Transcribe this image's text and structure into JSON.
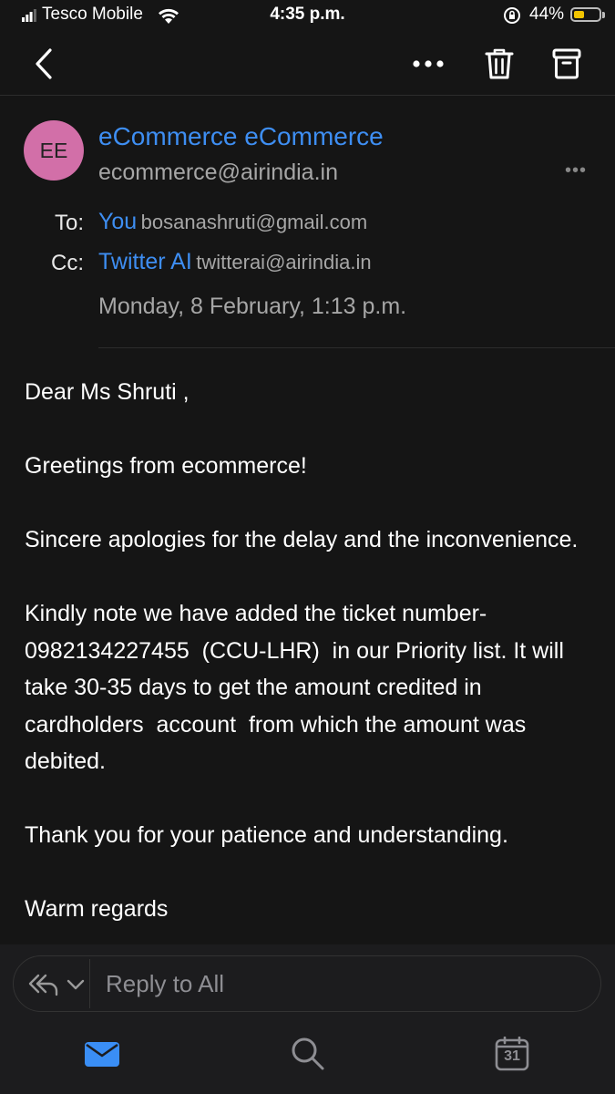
{
  "status_bar": {
    "carrier": "Tesco Mobile",
    "time": "4:35 p.m.",
    "battery_percent": "44%",
    "battery_level": 0.44
  },
  "nav": {
    "back_icon": "chevron-left-icon",
    "more_icon": "ellipsis-icon",
    "delete_icon": "trash-icon",
    "archive_icon": "archive-icon"
  },
  "header": {
    "avatar_initials": "EE",
    "sender_name": "eCommerce eCommerce",
    "sender_email": "ecommerce@airindia.in",
    "more": "•••",
    "to_label": "To:",
    "to_name": "You",
    "to_email": "bosanashruti@gmail.com",
    "cc_label": "Cc:",
    "cc_name": "Twitter AI",
    "cc_email": "twitterai@airindia.in",
    "date": "Monday, 8 February, 1:13 p.m.",
    "avatar_color": "#d26fa8",
    "accent_color": "#3e8ef2"
  },
  "body": {
    "p1": "Dear Ms Shruti ,",
    "p2": "Greetings from ecommerce!",
    "p3": "Sincere apologies for the delay and the inconvenience.",
    "p4": "Kindly note we have added the ticket number- 0982134227455  (CCU-LHR)  in our Priority list. It will take 30-35 days to get the amount credited in cardholders  account  from which the amount was debited.",
    "p5": "Thank you for your patience and understanding.",
    "p6": "Warm regards"
  },
  "reply": {
    "icon": "reply-all-icon",
    "dropdown_icon": "chevron-down-icon",
    "label": "Reply to All"
  },
  "tabs": {
    "mail_icon": "mail-icon",
    "search_icon": "search-icon",
    "calendar_icon": "calendar-icon",
    "calendar_day": "31"
  }
}
